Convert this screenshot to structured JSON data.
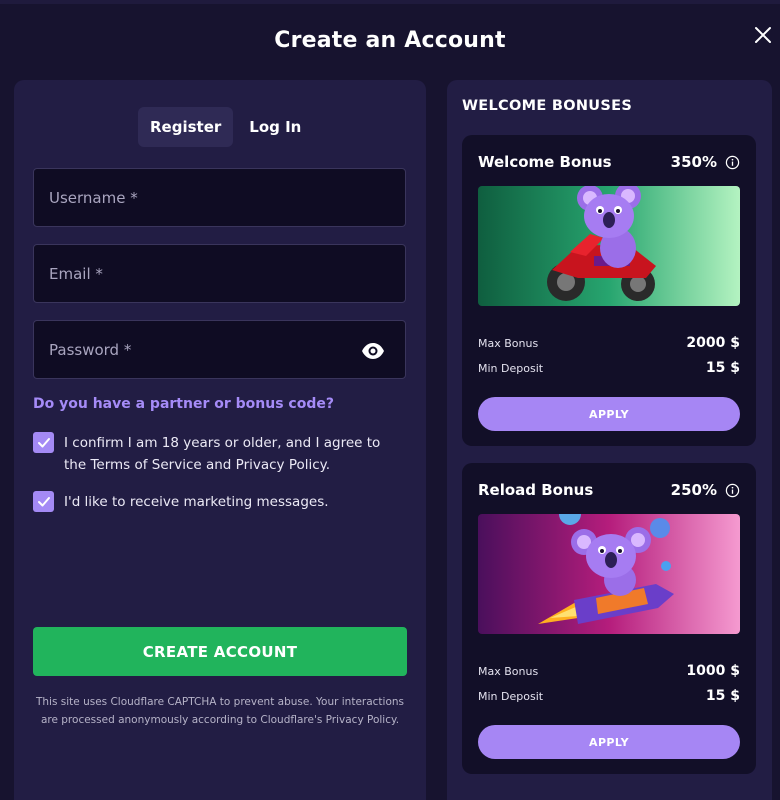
{
  "modal": {
    "title": "Create an Account"
  },
  "tabs": [
    {
      "label": "Register",
      "active": true
    },
    {
      "label": "Log In",
      "active": false
    }
  ],
  "form": {
    "username_placeholder": "Username *",
    "email_placeholder": "Email *",
    "password_placeholder": "Password *",
    "partner_link": "Do you have a partner or bonus code?",
    "age_confirm": "I confirm I am 18 years or older, and I agree to the Terms of Service and Privacy Policy.",
    "age_confirm_checked": true,
    "marketing": "I'd like to receive marketing messages.",
    "marketing_checked": true,
    "submit_label": "CREATE ACCOUNT",
    "captcha_note": "This site uses Cloudflare CAPTCHA to prevent abuse. Your interactions are processed anonymously according to Cloudflare's Privacy Policy."
  },
  "bonuses": {
    "title": "WELCOME BONUSES",
    "cards": [
      {
        "name": "Welcome Bonus",
        "percent": "350%",
        "max_bonus_label": "Max Bonus",
        "max_bonus": "2000 $",
        "min_deposit_label": "Min Deposit",
        "min_deposit": "15 $",
        "apply_label": "APPLY",
        "banner": "koala-on-motorbike"
      },
      {
        "name": "Reload Bonus",
        "percent": "250%",
        "max_bonus_label": "Max Bonus",
        "max_bonus": "1000 $",
        "min_deposit_label": "Min Deposit",
        "min_deposit": "15 $",
        "apply_label": "APPLY",
        "banner": "koala-on-rocket"
      }
    ]
  },
  "colors": {
    "background": "#17132f",
    "panel": "#221d44",
    "card": "#120f28",
    "accent_purple": "#a686f4",
    "create_green": "#21b45c",
    "link_purple": "#a58bf7"
  },
  "icons": {
    "close": "close-icon",
    "password_toggle": "eye-icon",
    "checkbox": "check-icon",
    "info": "info-icon"
  }
}
